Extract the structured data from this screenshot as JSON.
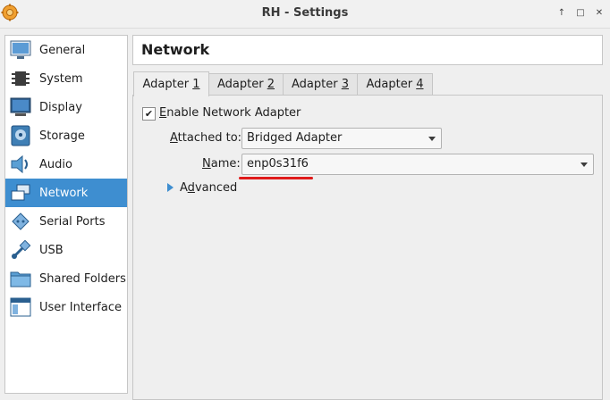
{
  "window": {
    "title": "RH - Settings"
  },
  "sidebar": {
    "items": [
      {
        "label": "General",
        "icon": "general-icon"
      },
      {
        "label": "System",
        "icon": "system-chip-icon"
      },
      {
        "label": "Display",
        "icon": "monitor-icon"
      },
      {
        "label": "Storage",
        "icon": "disk-icon"
      },
      {
        "label": "Audio",
        "icon": "speaker-icon"
      },
      {
        "label": "Network",
        "icon": "network-icon",
        "active": true
      },
      {
        "label": "Serial Ports",
        "icon": "serial-port-icon"
      },
      {
        "label": "USB",
        "icon": "usb-icon"
      },
      {
        "label": "Shared Folders",
        "icon": "folder-icon"
      },
      {
        "label": "User Interface",
        "icon": "window-icon"
      }
    ]
  },
  "header": {
    "title": "Network"
  },
  "tabs": [
    {
      "prefix": "Adapter ",
      "mnemonic": "1",
      "active": true
    },
    {
      "prefix": "Adapter ",
      "mnemonic": "2"
    },
    {
      "prefix": "Adapter ",
      "mnemonic": "3"
    },
    {
      "prefix": "Adapter ",
      "mnemonic": "4"
    }
  ],
  "adapter": {
    "enable": {
      "mnemonic": "E",
      "rest": "nable Network Adapter",
      "checked": true
    },
    "attached": {
      "mnemonic": "A",
      "rest": "ttached to:",
      "value": "Bridged Adapter"
    },
    "name": {
      "mnemonic": "N",
      "rest": "ame:",
      "value": "enp0s31f6"
    },
    "advanced": {
      "prefix": "A",
      "mnemonic": "d",
      "rest": "vanced"
    }
  },
  "colors": {
    "accent": "#3e8ed0",
    "highlight_underline": "#e01b1b"
  }
}
